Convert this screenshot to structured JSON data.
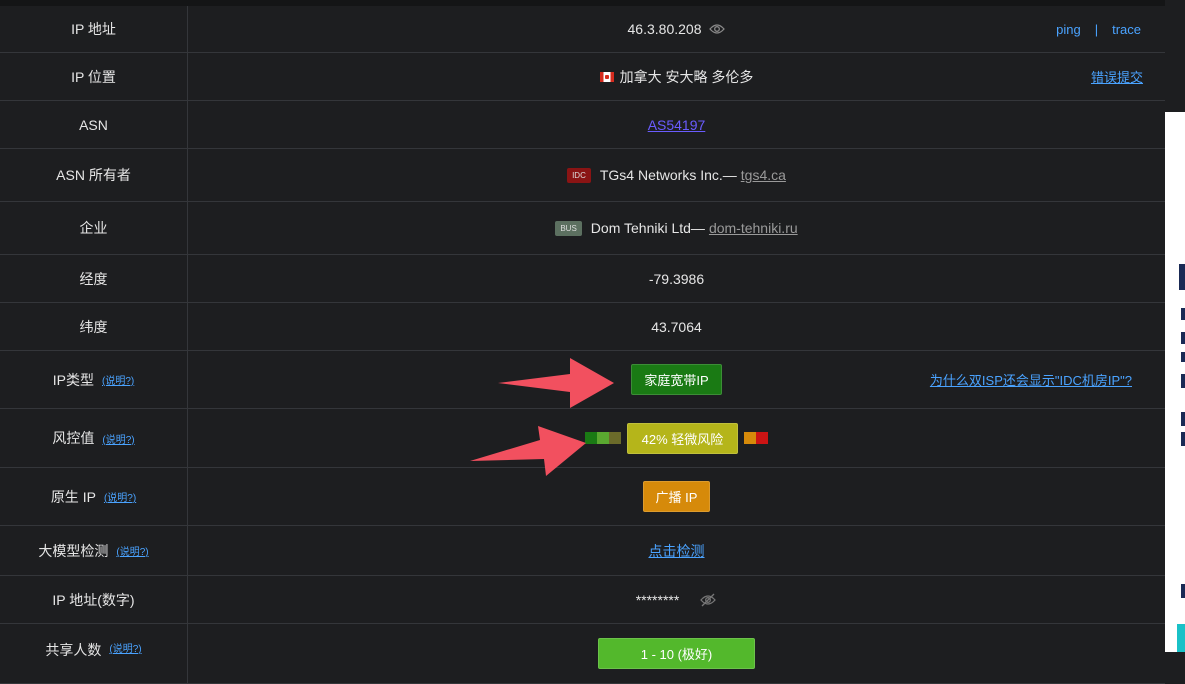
{
  "rows": [
    {
      "label": "IP 地址",
      "value": "46.3.80.208",
      "links": [
        "ping",
        "|",
        "trace"
      ]
    },
    {
      "label": "IP 位置",
      "value": "加拿大 安大略 多伦多",
      "link": "错误提交"
    },
    {
      "label": "ASN",
      "value": "AS54197"
    },
    {
      "label": "ASN 所有者",
      "tag": "IDC",
      "value": "TGs4 Networks Inc.—",
      "link": "tgs4.ca"
    },
    {
      "label": "企业",
      "tag": "BUS",
      "value": "Dom Tehniki Ltd—",
      "link": "dom-tehniki.ru"
    },
    {
      "label": "经度",
      "value": "-79.3986"
    },
    {
      "label": "纬度",
      "value": "43.7064"
    },
    {
      "label": "IP类型",
      "note": "(说明?)",
      "value": "家庭宽带IP",
      "link": "为什么双ISP还会显示\"IDC机房IP\"?"
    },
    {
      "label": "风控值",
      "note": "(说明?)",
      "value": "42%  轻微风险"
    },
    {
      "label": "原生 IP",
      "note": "(说明?)",
      "value": "广播 IP"
    },
    {
      "label": "大模型检测",
      "note": "(说明?)",
      "value": "点击检测"
    },
    {
      "label": "IP 地址(数字)",
      "value": "********"
    },
    {
      "label": "共享人数",
      "note": "(说明?)",
      "value": "1 - 10 (极好)"
    }
  ],
  "colors": {
    "green_badge": "#1a7a14",
    "yellow_badge": "#b5b51a",
    "orange_badge": "#d68a0a",
    "share_badge": "#53b82c",
    "arrow": "#f2505f"
  }
}
